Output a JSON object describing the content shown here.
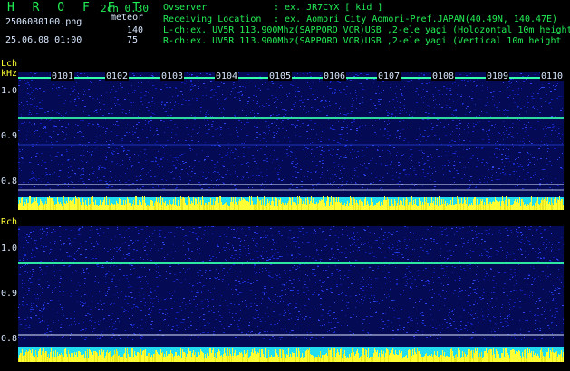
{
  "header": {
    "app_title": "H R O F F T",
    "version": "2ch 0.30",
    "filename": "2506080100.png",
    "datetime": "25.06.08 01:00",
    "meteor_label": "meteor",
    "lch_count": "140",
    "rch_count": "75",
    "observer_label": "Ovserver",
    "observer_value": ": ex. JR7CYX [ kid ]",
    "location_label": "Receiving Location",
    "location_value": ": ex. Aomori City Aomori-Pref.JAPAN(40.49N, 140.47E)",
    "lch_info": "L-ch:ex. UV5R 113.900Mhz(SAPPORO VOR)USB ,2-ele yagi (Holozontal 10m height",
    "rch_info": "R-ch:ex. UV5R 113.900Mhz(SAPPORO VOR)USB ,2-ele yagi (Vertical 10m height"
  },
  "lch_panel": {
    "label": "Lch",
    "unit": "kHz",
    "y_ticks": [
      "1.0",
      "0.9",
      "0.8"
    ],
    "time_ticks": [
      "0101",
      "0102",
      "0103",
      "0104",
      "0105",
      "0106",
      "0107",
      "0108",
      "0109",
      "0110"
    ]
  },
  "rch_panel": {
    "label": "Rch",
    "y_ticks": [
      "1.0",
      "0.9",
      "0.8"
    ]
  },
  "colors": {
    "background": "#000000",
    "header_text": "#22ee55",
    "axis_label": "#ffff33",
    "spectrum_blue": "#0a1aa0",
    "signal_line": "#33ffaa",
    "level_yellow": "#ffff33",
    "level_cyan": "#22ddee"
  }
}
